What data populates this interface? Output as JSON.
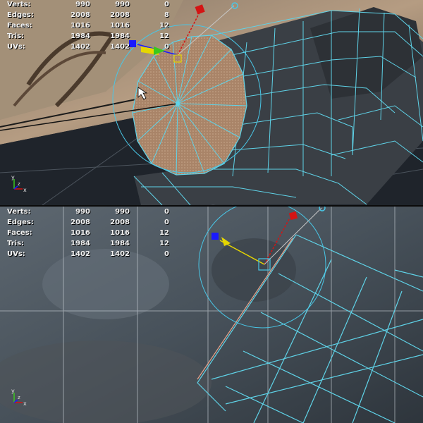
{
  "viewports": {
    "top": {
      "stats": [
        {
          "label": "Verts:",
          "v1": "990",
          "v2": "990",
          "v3": "0"
        },
        {
          "label": "Edges:",
          "v1": "2008",
          "v2": "2008",
          "v3": "8"
        },
        {
          "label": "Faces:",
          "v1": "1016",
          "v2": "1016",
          "v3": "12"
        },
        {
          "label": "Tris:",
          "v1": "1984",
          "v2": "1984",
          "v3": "12"
        },
        {
          "label": "UVs:",
          "v1": "1402",
          "v2": "1402",
          "v3": "0"
        }
      ],
      "axis": {
        "y": "y",
        "x": "x",
        "z": "z"
      }
    },
    "bottom": {
      "stats": [
        {
          "label": "Verts:",
          "v1": "990",
          "v2": "990",
          "v3": "0"
        },
        {
          "label": "Edges:",
          "v1": "2008",
          "v2": "2008",
          "v3": "0"
        },
        {
          "label": "Faces:",
          "v1": "1016",
          "v2": "1016",
          "v3": "12"
        },
        {
          "label": "Tris:",
          "v1": "1984",
          "v2": "1984",
          "v3": "12"
        },
        {
          "label": "UVs:",
          "v1": "1402",
          "v2": "1402",
          "v3": "0"
        }
      ],
      "axis": {
        "y": "y",
        "x": "x",
        "z": "z"
      }
    }
  },
  "colors": {
    "wire": "#5fd3e8",
    "selected_face": "#b08a6c",
    "manip_x": "#d41414",
    "manip_y": "#1a1aff",
    "manip_z": "#e6d600",
    "manip_circle": "#49c6e6"
  },
  "icons": [
    "move-manipulator-icon",
    "pointer-cursor-icon",
    "view-axis-icon"
  ]
}
